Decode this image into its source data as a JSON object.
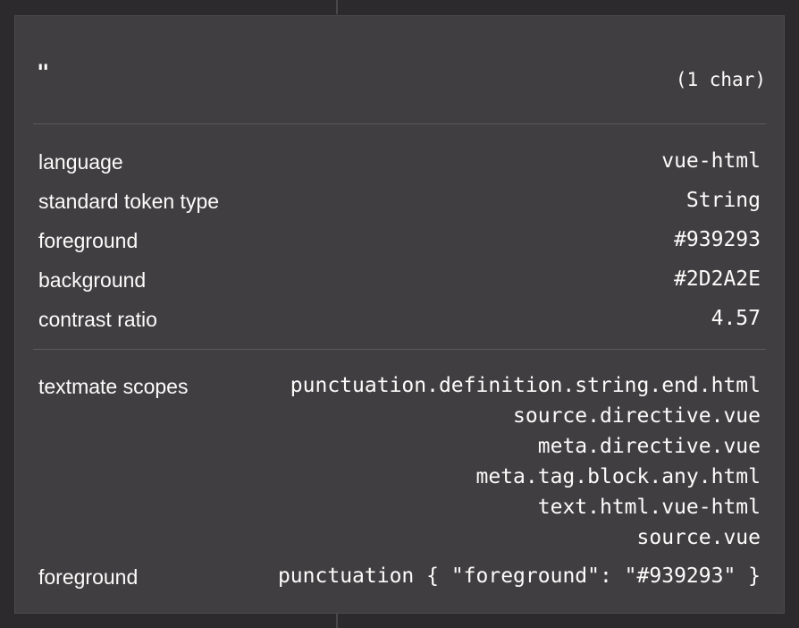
{
  "token": {
    "text": "\"",
    "char_count": "(1 char)"
  },
  "info": [
    {
      "label": "language",
      "value": "vue-html"
    },
    {
      "label": "standard token type",
      "value": "String"
    },
    {
      "label": "foreground",
      "value": "#939293"
    },
    {
      "label": "background",
      "value": "#2D2A2E"
    },
    {
      "label": "contrast ratio",
      "value": "4.57"
    }
  ],
  "textmate": {
    "label": "textmate scopes",
    "scopes": [
      "punctuation.definition.string.end.html",
      "source.directive.vue",
      "meta.directive.vue",
      "meta.tag.block.any.html",
      "text.html.vue-html",
      "source.vue"
    ]
  },
  "foreground_rule": {
    "label": "foreground",
    "value": "punctuation { \"foreground\": \"#939293\" }"
  },
  "colors": {
    "editor_background": "#2D2A2E",
    "panel_background": "#403E41",
    "text": "#FCFCFA"
  }
}
